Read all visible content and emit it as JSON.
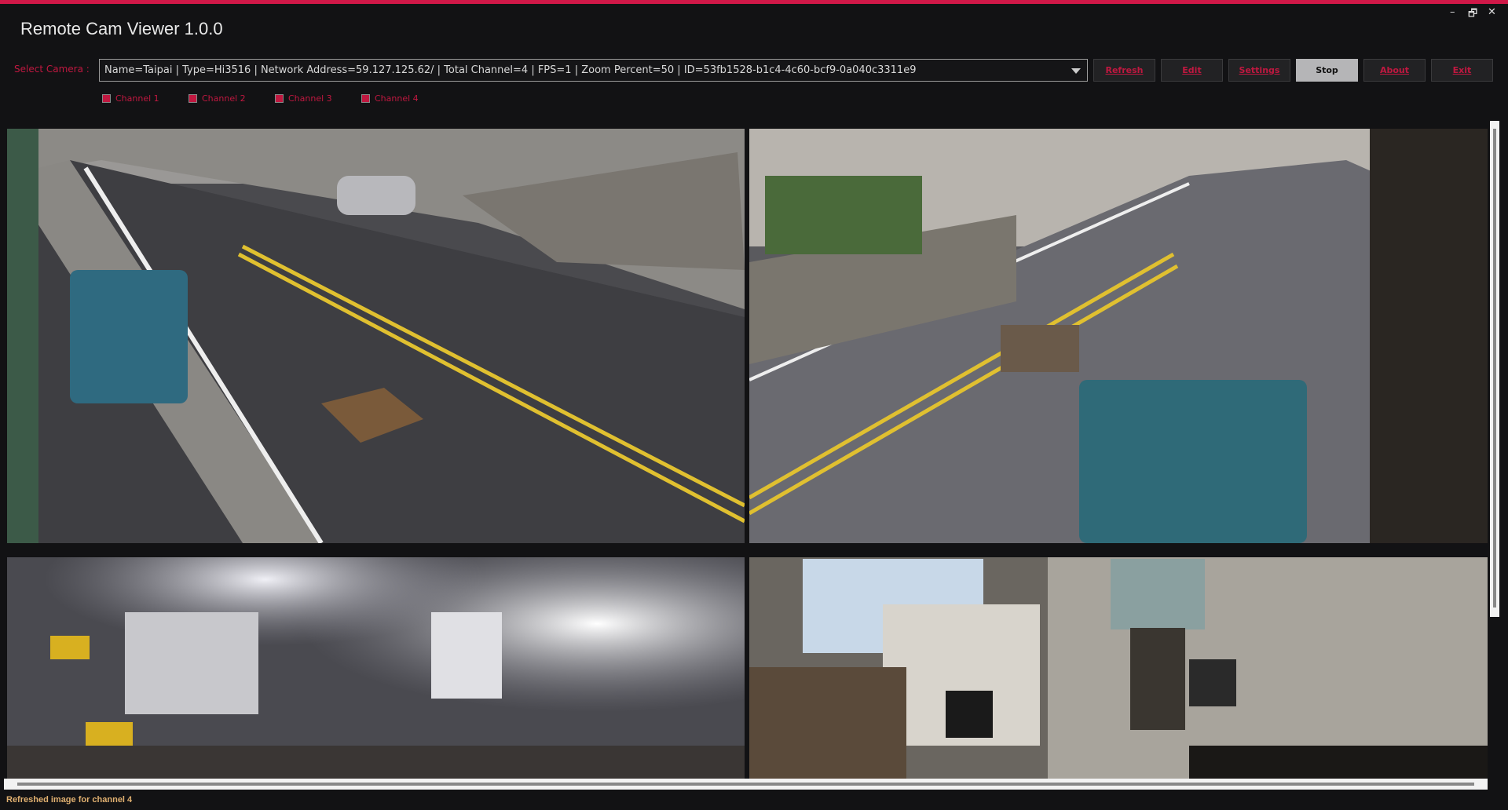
{
  "window": {
    "title": "Remote Cam Viewer 1.0.0",
    "minimize": "–",
    "restore": "🗗",
    "close": "✕"
  },
  "toolbar": {
    "select_label": "Select Camera :",
    "camera_selected": "Name=Taipai | Type=Hi3516 | Network Address=59.127.125.62/ | Total Channel=4 | FPS=1 | Zoom Percent=50 | ID=53fb1528-b1c4-4c60-bcf9-0a040c3311e9",
    "buttons": [
      "Refresh",
      "Edit",
      "Settings",
      "Stop",
      "About",
      "Exit"
    ]
  },
  "channels": [
    {
      "label": "Channel 1",
      "checked": true
    },
    {
      "label": "Channel 2",
      "checked": true
    },
    {
      "label": "Channel 3",
      "checked": true
    },
    {
      "label": "Channel 4",
      "checked": true
    }
  ],
  "status": "Refreshed image for channel 4",
  "colors": {
    "accent": "#d01848",
    "background": "#121214",
    "status_text": "#e0b070"
  }
}
